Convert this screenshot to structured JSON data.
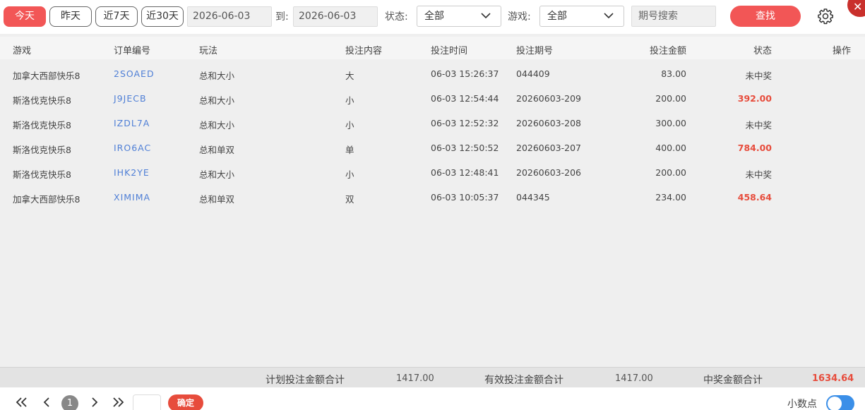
{
  "toolbar": {
    "ranges": [
      "今天",
      "昨天",
      "近7天",
      "近30天"
    ],
    "date_from": "2026-06-03",
    "to_label": "到:",
    "date_to": "2026-06-03",
    "status_label": "状态:",
    "status_value": "全部",
    "game_label": "游戏:",
    "game_value": "全部",
    "search_placeholder": "期号搜索",
    "find_label": "查找"
  },
  "table": {
    "headers": [
      "游戏",
      "订单编号",
      "玩法",
      "投注内容",
      "投注时间",
      "投注期号",
      "投注金额",
      "状态",
      "操作"
    ],
    "rows": [
      {
        "game": "加拿大西部快乐8",
        "order": "2SOAED",
        "play": "总和大小",
        "content": "大",
        "time": "06-03 15:26:37",
        "period": "044409",
        "amount": "83.00",
        "status": "未中奖",
        "win": false
      },
      {
        "game": "斯洛伐克快乐8",
        "order": "J9JECB",
        "play": "总和大小",
        "content": "小",
        "time": "06-03 12:54:44",
        "period": "20260603-209",
        "amount": "200.00",
        "status": "392.00",
        "win": true
      },
      {
        "game": "斯洛伐克快乐8",
        "order": "IZDL7A",
        "play": "总和大小",
        "content": "小",
        "time": "06-03 12:52:32",
        "period": "20260603-208",
        "amount": "300.00",
        "status": "未中奖",
        "win": false
      },
      {
        "game": "斯洛伐克快乐8",
        "order": "IRO6AC",
        "play": "总和单双",
        "content": "单",
        "time": "06-03 12:50:52",
        "period": "20260603-207",
        "amount": "400.00",
        "status": "784.00",
        "win": true
      },
      {
        "game": "斯洛伐克快乐8",
        "order": "IHK2YE",
        "play": "总和大小",
        "content": "小",
        "time": "06-03 12:48:41",
        "period": "20260603-206",
        "amount": "200.00",
        "status": "未中奖",
        "win": false
      },
      {
        "game": "加拿大西部快乐8",
        "order": "XIMIMA",
        "play": "总和单双",
        "content": "双",
        "time": "06-03 10:05:37",
        "period": "044345",
        "amount": "234.00",
        "status": "458.64",
        "win": true
      }
    ]
  },
  "summary": {
    "planned_label": "计划投注金额合计",
    "planned_value": "1417.00",
    "valid_label": "有效投注金额合计",
    "valid_value": "1417.00",
    "win_label": "中奖金额合计",
    "win_value": "1634.64"
  },
  "pager": {
    "current_page": "1",
    "confirm_label": "确定",
    "decimal_label": "小数点"
  },
  "colors": {
    "accent": "#f25656",
    "win": "#e74c3c",
    "link": "#4f7fd6",
    "toggle": "#3b8fe8"
  }
}
